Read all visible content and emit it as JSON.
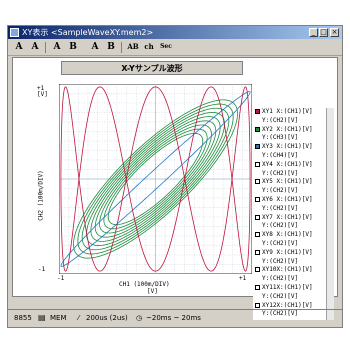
{
  "window": {
    "title": "XY表示 <SampleWaveXY.mem2>"
  },
  "toolbar": {
    "buttons": [
      "A",
      "A",
      "A",
      "B",
      "A",
      "B",
      "AB",
      "ch",
      "Sec"
    ]
  },
  "chart_title": "X-Yサンプル波形",
  "axes": {
    "y_top": "+1",
    "y_unit": "[V]",
    "y_bottom": "-1",
    "y_label": "CH2 (100m/DIV)",
    "x_left": "-1",
    "x_right": "+1",
    "x_label": "CH1 (100m/DIV)",
    "x_unit": "[V]"
  },
  "legend": [
    {
      "text": "XY1 X:(CH1)[V]",
      "color": "#c0143c",
      "filled": true
    },
    {
      "text": "    Y:(CH2)[V]",
      "color": null
    },
    {
      "text": "XY2 X:(CH1)[V]",
      "color": "#1e8c3c",
      "filled": true
    },
    {
      "text": "    Y:(CH3)[V]",
      "color": null
    },
    {
      "text": "XY3 X:(CH1)[V]",
      "color": "#1e78c8",
      "filled": true
    },
    {
      "text": "    Y:(CH4)[V]",
      "color": null
    },
    {
      "text": "XY4 X:(CH1)[V]",
      "color": "#ffffff",
      "filled": false
    },
    {
      "text": "    Y:(CH2)[V]",
      "color": null
    },
    {
      "text": "XY5 X:(CH1)[V]",
      "color": "#ffffff",
      "filled": false
    },
    {
      "text": "    Y:(CH2)[V]",
      "color": null
    },
    {
      "text": "XY6 X:(CH1)[V]",
      "color": "#ffffff",
      "filled": false
    },
    {
      "text": "    Y:(CH2)[V]",
      "color": null
    },
    {
      "text": "XY7 X:(CH1)[V]",
      "color": "#ffffff",
      "filled": false
    },
    {
      "text": "    Y:(CH2)[V]",
      "color": null
    },
    {
      "text": "XY8 X:(CH1)[V]",
      "color": "#ffffff",
      "filled": false
    },
    {
      "text": "    Y:(CH2)[V]",
      "color": null
    },
    {
      "text": "XY9 X:(CH1)[V]",
      "color": "#ffffff",
      "filled": false
    },
    {
      "text": "    Y:(CH2)[V]",
      "color": null
    },
    {
      "text": "XY10X:(CH1)[V]",
      "color": "#ffffff",
      "filled": false
    },
    {
      "text": "    Y:(CH2)[V]",
      "color": null
    },
    {
      "text": "XY11X:(CH1)[V]",
      "color": "#ffffff",
      "filled": false
    },
    {
      "text": "    Y:(CH2)[V]",
      "color": null
    },
    {
      "text": "XY12X:(CH1)[V]",
      "color": "#ffffff",
      "filled": false
    },
    {
      "text": "    Y:(CH2)[V]",
      "color": null
    }
  ],
  "statusbar": {
    "model": "8855",
    "mode": "MEM",
    "timebase": "200us (2us)",
    "range": "~20ms ~ 20ms"
  },
  "colors": {
    "grid": "#a0b8d0",
    "xy1": "#c0143c",
    "xy2": "#1e8c3c",
    "xy3": "#1e78c8"
  }
}
